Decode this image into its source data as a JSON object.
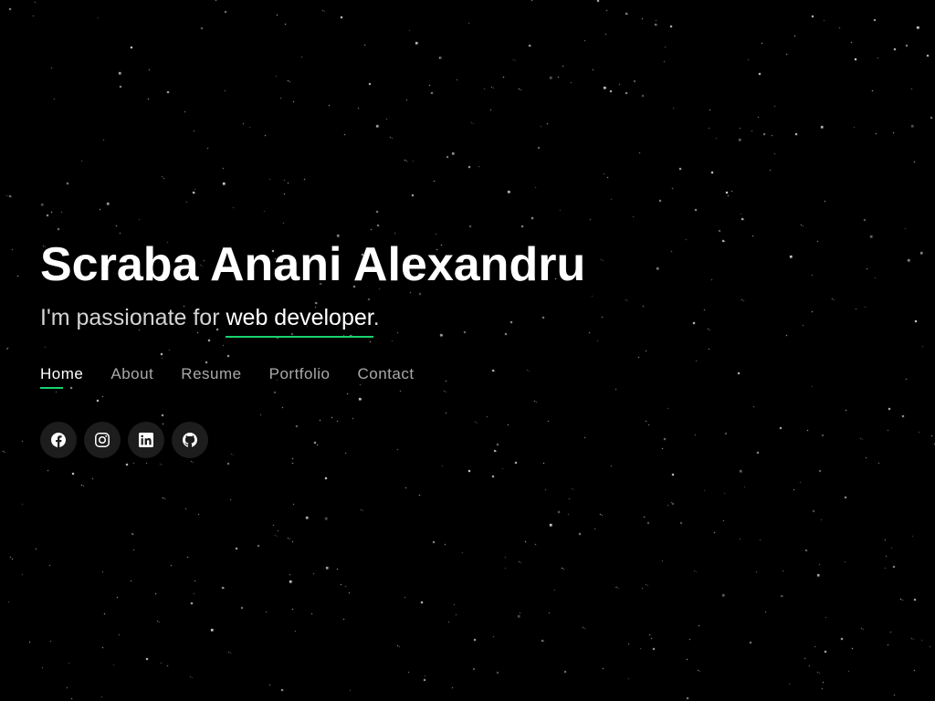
{
  "hero": {
    "name": "Scraba Anani Alexandru",
    "tagline_prefix": "I'm passionate for ",
    "tagline_highlight": "web developer",
    "tagline_suffix": "."
  },
  "nav": {
    "items": [
      {
        "label": "Home",
        "active": true
      },
      {
        "label": "About",
        "active": false
      },
      {
        "label": "Resume",
        "active": false
      },
      {
        "label": "Portfolio",
        "active": false
      },
      {
        "label": "Contact",
        "active": false
      }
    ]
  },
  "social": [
    {
      "network": "facebook",
      "icon": "facebook-icon"
    },
    {
      "network": "instagram",
      "icon": "instagram-icon"
    },
    {
      "network": "linkedin",
      "icon": "linkedin-icon"
    },
    {
      "network": "github",
      "icon": "github-icon"
    }
  ],
  "colors": {
    "accent": "#18d26e",
    "background": "#000000",
    "text": "#ffffff",
    "muted": "#a9a9a9",
    "icon_background": "#1d1d1d"
  }
}
